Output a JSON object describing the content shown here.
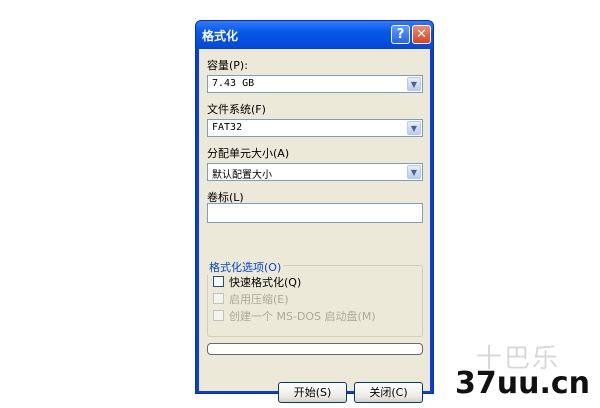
{
  "dialog": {
    "title": "格式化",
    "help_label": "?",
    "close_label": "✕"
  },
  "fields": {
    "capacity_label": "容量(P):",
    "capacity_value": "7.43 GB",
    "filesystem_label": "文件系统(F)",
    "filesystem_value": "FAT32",
    "unit_size_label": "分配单元大小(A)",
    "unit_size_value": "默认配置大小",
    "volume_label": "卷标(L)",
    "volume_value": "",
    "dropdown_arrow": "▼"
  },
  "options": {
    "group_title": "格式化选项(O)",
    "quick_format": "快速格式化(Q)",
    "compression": "启用压缩(E)",
    "msdos_disk": "创建一个 MS-DOS 启动盘(M)"
  },
  "buttons": {
    "start": "开始(S)",
    "close": "关闭(C)"
  },
  "watermark": {
    "site_chinese": "十巴乐",
    "site": "37uu.cn"
  }
}
